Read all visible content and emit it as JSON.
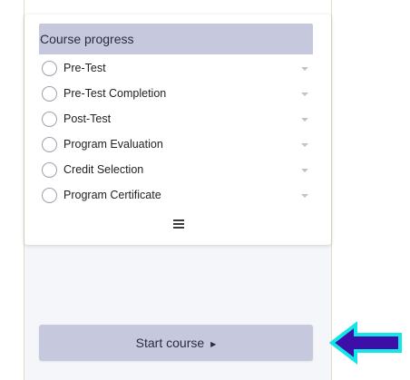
{
  "course_progress": {
    "title": "Course progress",
    "steps": [
      {
        "label": "Pre-Test"
      },
      {
        "label": "Pre-Test Completion"
      },
      {
        "label": "Post-Test"
      },
      {
        "label": "Program Evaluation"
      },
      {
        "label": "Credit Selection"
      },
      {
        "label": "Program Certificate"
      }
    ],
    "menu_icon": "hamburger-icon",
    "step_status_icon": "empty-circle-icon",
    "expand_icon": "caret-down-icon"
  },
  "start_button": {
    "label": "Start course",
    "icon": "caret-right-icon"
  },
  "annotation": {
    "icon": "left-arrow-icon",
    "fill_color": "#3d0fa8",
    "outline_color": "#14e6e6"
  },
  "colors": {
    "header_bg": "#c6c9de",
    "button_bg": "#c6c9de",
    "panel_bg": "#f5f6fa"
  }
}
